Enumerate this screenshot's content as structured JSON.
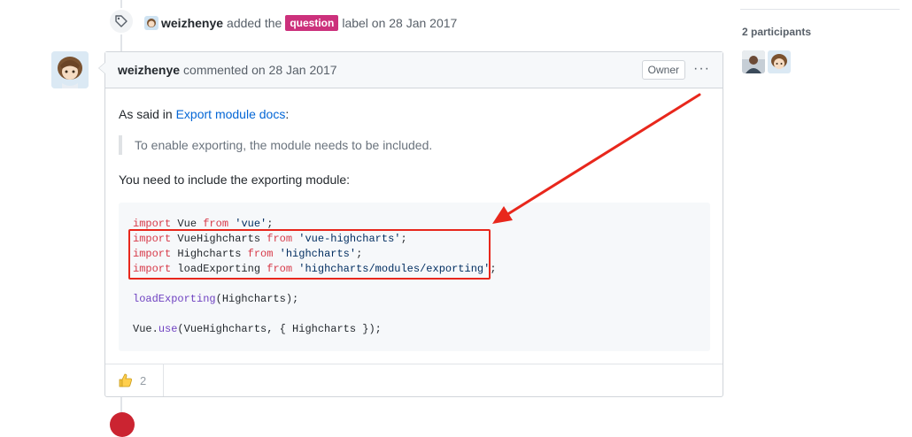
{
  "event": {
    "actor": "weizhenye",
    "text_before": "added the",
    "label": "question",
    "text_after": "label on 28 Jan 2017",
    "icon": "tag-icon",
    "label_color": "#cc317c"
  },
  "comment": {
    "author": "weizhenye",
    "meta": "commented on 28 Jan 2017",
    "badge": "Owner",
    "menu_icon": "kebab-icon",
    "body": {
      "para1_before": "As said in",
      "para1_link": "Export module docs",
      "para1_after": ":",
      "quote": "To enable exporting, the module needs to be included.",
      "para2": "You need to include the exporting module:"
    },
    "code": [
      [
        {
          "t": "import",
          "c": "kw"
        },
        {
          "t": " Vue "
        },
        {
          "t": "from",
          "c": "kw"
        },
        {
          "t": " "
        },
        {
          "t": "'vue'",
          "c": "str"
        },
        {
          "t": ";"
        }
      ],
      [
        {
          "t": "import",
          "c": "kw"
        },
        {
          "t": " VueHighcharts "
        },
        {
          "t": "from",
          "c": "kw"
        },
        {
          "t": " "
        },
        {
          "t": "'vue-highcharts'",
          "c": "str"
        },
        {
          "t": ";"
        }
      ],
      [
        {
          "t": "import",
          "c": "kw"
        },
        {
          "t": " Highcharts "
        },
        {
          "t": "from",
          "c": "kw"
        },
        {
          "t": " "
        },
        {
          "t": "'highcharts'",
          "c": "str"
        },
        {
          "t": ";"
        }
      ],
      [
        {
          "t": "import",
          "c": "kw"
        },
        {
          "t": " loadExporting "
        },
        {
          "t": "from",
          "c": "kw"
        },
        {
          "t": " "
        },
        {
          "t": "'highcharts/modules/exporting'",
          "c": "str"
        },
        {
          "t": ";"
        }
      ],
      [],
      [
        {
          "t": "loadExporting",
          "c": "fn"
        },
        {
          "t": "(Highcharts);"
        }
      ],
      [],
      [
        {
          "t": "Vue."
        },
        {
          "t": "use",
          "c": "fn"
        },
        {
          "t": "(VueHighcharts, { Highcharts });"
        }
      ]
    ],
    "reaction": {
      "icon": "thumbs-up-icon",
      "count": "2"
    }
  },
  "annotation": {
    "color": "#e8271c",
    "highlight": "red-rectangle",
    "pointer": "red-arrow"
  },
  "sidebar": {
    "participants_title": "2 participants",
    "participants": [
      "participant-1-avatar",
      "participant-2-avatar"
    ]
  }
}
